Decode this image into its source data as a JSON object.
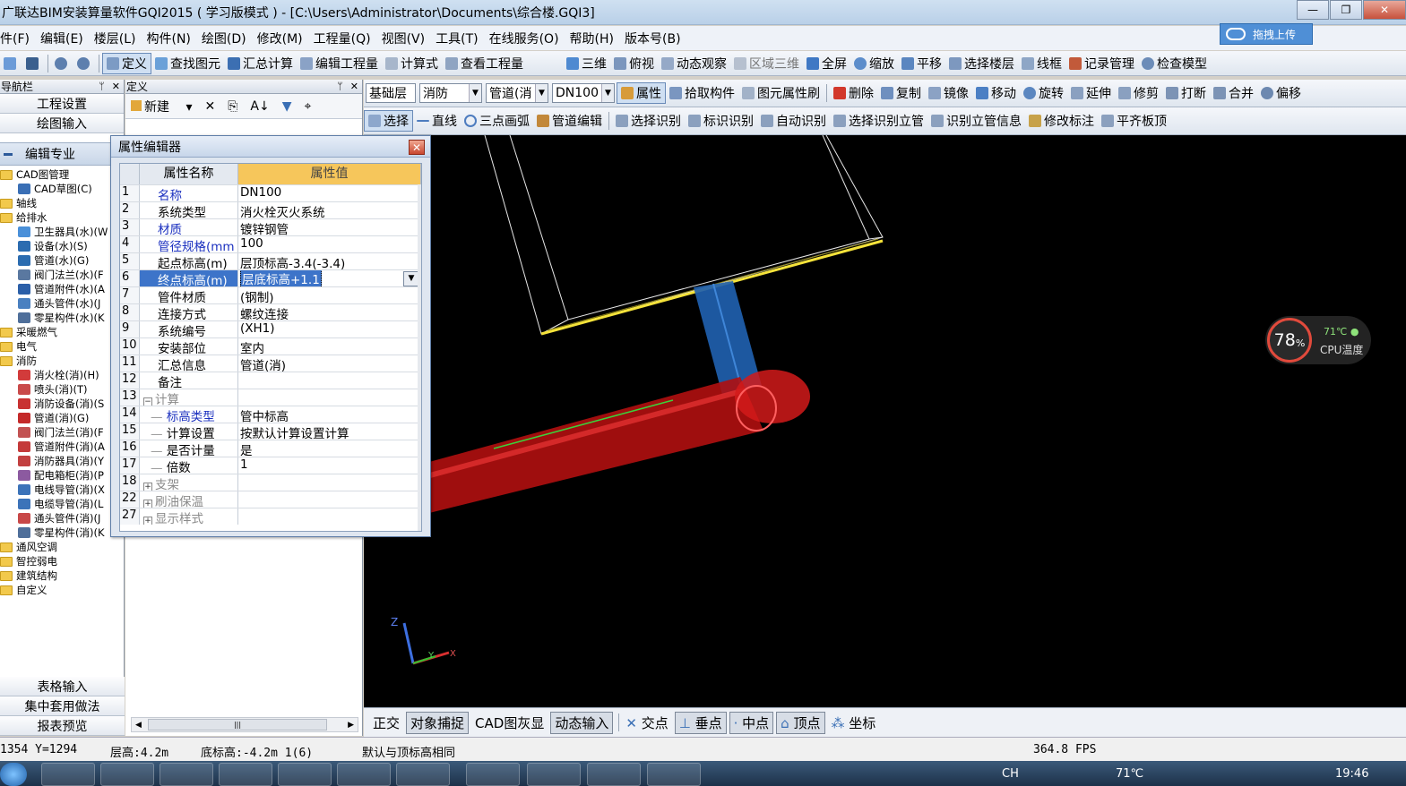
{
  "window": {
    "title": "广联达BIM安装算量软件GQI2015 ( 学习版模式 ) - [C:\\Users\\Administrator\\Documents\\综合楼.GQI3]",
    "min": "—",
    "max": "❐",
    "close": "✕",
    "upload": "拖拽上传"
  },
  "menu": [
    "件(F)",
    "编辑(E)",
    "楼层(L)",
    "构件(N)",
    "绘图(D)",
    "修改(M)",
    "工程量(Q)",
    "视图(V)",
    "工具(T)",
    "在线服务(O)",
    "帮助(H)",
    "版本号(B)"
  ],
  "toolbar1": {
    "define": "定义",
    "find": "查找图元",
    "sum": "汇总计算",
    "edit_qty": "编辑工程量",
    "formula": "计算式",
    "view_qty": "查看工程量",
    "view3d": "三维",
    "top": "俯视",
    "dynamic": "动态观察",
    "region3d": "区域三维",
    "full": "全屏",
    "zoom": "缩放",
    "pan": "平移",
    "floor": "选择楼层",
    "wire": "线框",
    "record": "记录管理",
    "check": "检查模型"
  },
  "toolbar2": {
    "layer": "基础层",
    "system": "消防",
    "type": "管道(消",
    "size": "DN100",
    "prop": "属性",
    "pick": "拾取构件",
    "brush": "图元属性刷",
    "del": "删除",
    "copy": "复制",
    "mirror": "镜像",
    "move": "移动",
    "rotate": "旋转",
    "extend": "延伸",
    "trim": "修剪",
    "break": "打断",
    "merge": "合并",
    "offset": "偏移"
  },
  "toolbar3": {
    "select": "选择",
    "line": "直线",
    "arc": "三点画弧",
    "pipe_edit": "管道编辑",
    "sel_ident": "选择识别",
    "mark_ident": "标识识别",
    "auto_ident": "自动识别",
    "sel_riser": "选择识别立管",
    "riser_info": "识别立管信息",
    "modify_mark": "修改标注",
    "flat_top": "平齐板顶"
  },
  "nav": {
    "head": "导航栏",
    "project": "工程设置",
    "draw": "绘图输入",
    "edit": "编辑专业",
    "tree": [
      {
        "label": "CAD图管理",
        "lvl": 0,
        "folder": true
      },
      {
        "label": "CAD草图(C)",
        "lvl": 1,
        "color": "#3a6fb5"
      },
      {
        "label": "轴线",
        "lvl": 0,
        "folder": true
      },
      {
        "label": "给排水",
        "lvl": 0,
        "folder": true
      },
      {
        "label": "卫生器具(水)(W",
        "lvl": 1,
        "color": "#4a90d9"
      },
      {
        "label": "设备(水)(S)",
        "lvl": 1,
        "color": "#2b6cb0"
      },
      {
        "label": "管道(水)(G)",
        "lvl": 1,
        "color": "#2b6cb0"
      },
      {
        "label": "阀门法兰(水)(F",
        "lvl": 1,
        "color": "#5a78a0"
      },
      {
        "label": "管道附件(水)(A",
        "lvl": 1,
        "color": "#2b5fa8"
      },
      {
        "label": "通头管件(水)(J",
        "lvl": 1,
        "color": "#4a80c0"
      },
      {
        "label": "零星构件(水)(K",
        "lvl": 1,
        "color": "#4f6f9a"
      },
      {
        "label": "采暖燃气",
        "lvl": 0,
        "folder": true
      },
      {
        "label": "电气",
        "lvl": 0,
        "folder": true
      },
      {
        "label": "消防",
        "lvl": 0,
        "folder": true
      },
      {
        "label": "消火栓(消)(H)",
        "lvl": 1,
        "color": "#d23b3b"
      },
      {
        "label": "喷头(消)(T)",
        "lvl": 1,
        "color": "#c94a4a"
      },
      {
        "label": "消防设备(消)(S",
        "lvl": 1,
        "color": "#c83232"
      },
      {
        "label": "管道(消)(G)",
        "lvl": 1,
        "color": "#c42a2a"
      },
      {
        "label": "阀门法兰(消)(F",
        "lvl": 1,
        "color": "#c25252"
      },
      {
        "label": "管道附件(消)(A",
        "lvl": 1,
        "color": "#c43a3a"
      },
      {
        "label": "消防器具(消)(Y",
        "lvl": 1,
        "color": "#c24040"
      },
      {
        "label": "配电箱柜(消)(P",
        "lvl": 1,
        "color": "#8c5aa0"
      },
      {
        "label": "电线导管(消)(X",
        "lvl": 1,
        "color": "#3c73b9"
      },
      {
        "label": "电缆导管(消)(L",
        "lvl": 1,
        "color": "#3c73b9"
      },
      {
        "label": "通头管件(消)(J",
        "lvl": 1,
        "color": "#c84848"
      },
      {
        "label": "零星构件(消)(K",
        "lvl": 1,
        "color": "#4f6f9a"
      },
      {
        "label": "通风空调",
        "lvl": 0,
        "folder": true
      },
      {
        "label": "智控弱电",
        "lvl": 0,
        "folder": true
      },
      {
        "label": "建筑结构",
        "lvl": 0,
        "folder": true
      },
      {
        "label": "自定义",
        "lvl": 0,
        "folder": true
      }
    ],
    "table_input": "表格输入",
    "set_method": "集中套用做法",
    "report": "报表预览"
  },
  "define_panel": {
    "head": "定义",
    "new": "新建",
    "delete": "✕",
    "copy": "⎘",
    "sort": "A↓",
    "filter": "▼",
    "find": "⌖",
    "scroll_thumb": "|||"
  },
  "dialog": {
    "title": "属性编辑器",
    "col_name": "属性名称",
    "col_value": "属性值",
    "rows": [
      {
        "n": "1",
        "k": "名称",
        "v": "DN100",
        "style": "blue"
      },
      {
        "n": "2",
        "k": "系统类型",
        "v": "消火栓灭火系统",
        "style": ""
      },
      {
        "n": "3",
        "k": "材质",
        "v": "镀锌钢管",
        "style": "blue"
      },
      {
        "n": "4",
        "k": "管径规格(mm",
        "v": "100",
        "style": "blue"
      },
      {
        "n": "5",
        "k": "起点标高(m)",
        "v": "层顶标高-3.4(-3.4)",
        "style": ""
      },
      {
        "n": "6",
        "k": "终点标高(m)",
        "v": "层底标高+1.1",
        "style": "sel"
      },
      {
        "n": "7",
        "k": "管件材质",
        "v": "(钢制)",
        "style": ""
      },
      {
        "n": "8",
        "k": "连接方式",
        "v": "螺纹连接",
        "style": ""
      },
      {
        "n": "9",
        "k": "系统编号",
        "v": "(XH1)",
        "style": ""
      },
      {
        "n": "10",
        "k": "安装部位",
        "v": "室内",
        "style": ""
      },
      {
        "n": "11",
        "k": "汇总信息",
        "v": "管道(消)",
        "style": ""
      },
      {
        "n": "12",
        "k": "备注",
        "v": "",
        "style": ""
      },
      {
        "n": "13",
        "k": "计算",
        "v": "",
        "style": "group-open"
      },
      {
        "n": "14",
        "k": "标高类型",
        "v": "管中标高",
        "style": "child-blue"
      },
      {
        "n": "15",
        "k": "计算设置",
        "v": "按默认计算设置计算",
        "style": "child"
      },
      {
        "n": "16",
        "k": "是否计量",
        "v": "是",
        "style": "child"
      },
      {
        "n": "17",
        "k": "倍数",
        "v": "1",
        "style": "child"
      },
      {
        "n": "18",
        "k": "支架",
        "v": "",
        "style": "group"
      },
      {
        "n": "22",
        "k": "刷油保温",
        "v": "",
        "style": "group"
      },
      {
        "n": "27",
        "k": "显示样式",
        "v": "",
        "style": "group"
      }
    ]
  },
  "cpu": {
    "percent": "78",
    "unit": "%",
    "temp": "71℃",
    "label": "CPU温度"
  },
  "axis": {
    "z": "Z",
    "y": "Y",
    "x": "X"
  },
  "bottom_tools": [
    "正交",
    "对象捕捉",
    "CAD图灰显",
    "动态输入",
    "交点",
    "垂点",
    "中点",
    "顶点",
    "坐标"
  ],
  "status": {
    "coords": "1354 Y=1294",
    "floor_h": "层高:4.2m",
    "bottom_h": "底标高:-4.2m 1(6)",
    "msg": "默认与顶标高相同",
    "fps": "364.8 FPS"
  },
  "taskbar": {
    "ime": "CH",
    "temp": "71℃",
    "time": "19:46"
  }
}
